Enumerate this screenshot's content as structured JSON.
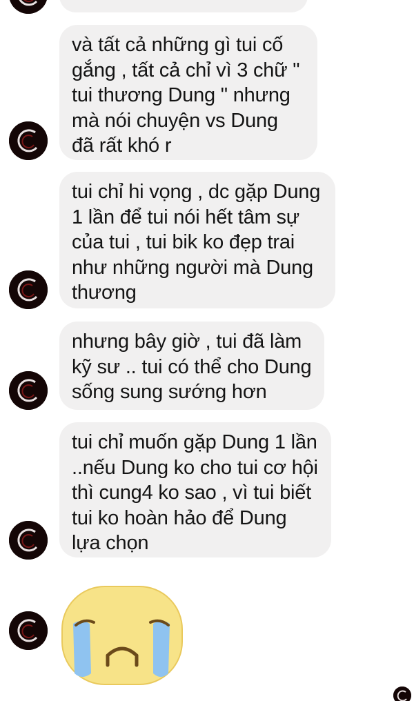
{
  "messages": [
    {
      "text": ""
    },
    {
      "text": "và tất cả những gì tui cố gắng , tất cả chỉ vì 3 chữ \" tui thương Dung \" nhưng mà nói chuyện vs Dung đã rất khó r"
    },
    {
      "text": "tui chỉ hi vọng , dc gặp Dung 1 lần để tui nói hết tâm sự của tui , tui bik ko đẹp trai như những người mà Dung thương"
    },
    {
      "text": "nhưng bây giờ , tui đã làm kỹ sư .. tui có thể cho Dung sống sung sướng hơn"
    },
    {
      "text": "tui chỉ muốn gặp Dung 1 lần ..nếu Dung ko cho tui cơ hội thì cung4 ko sao , vì tui biết tui ko hoàn hảo để Dung lựa chọn"
    }
  ],
  "icons": {
    "avatar": "avatar-icon",
    "emoji": "crying-face-icon",
    "read_receipt": "read-receipt-avatar-icon"
  },
  "colors": {
    "bubble": "#f1f0f0",
    "text": "#141414",
    "emoji_face": "#f7e388",
    "tears": "#8fc3f0"
  }
}
